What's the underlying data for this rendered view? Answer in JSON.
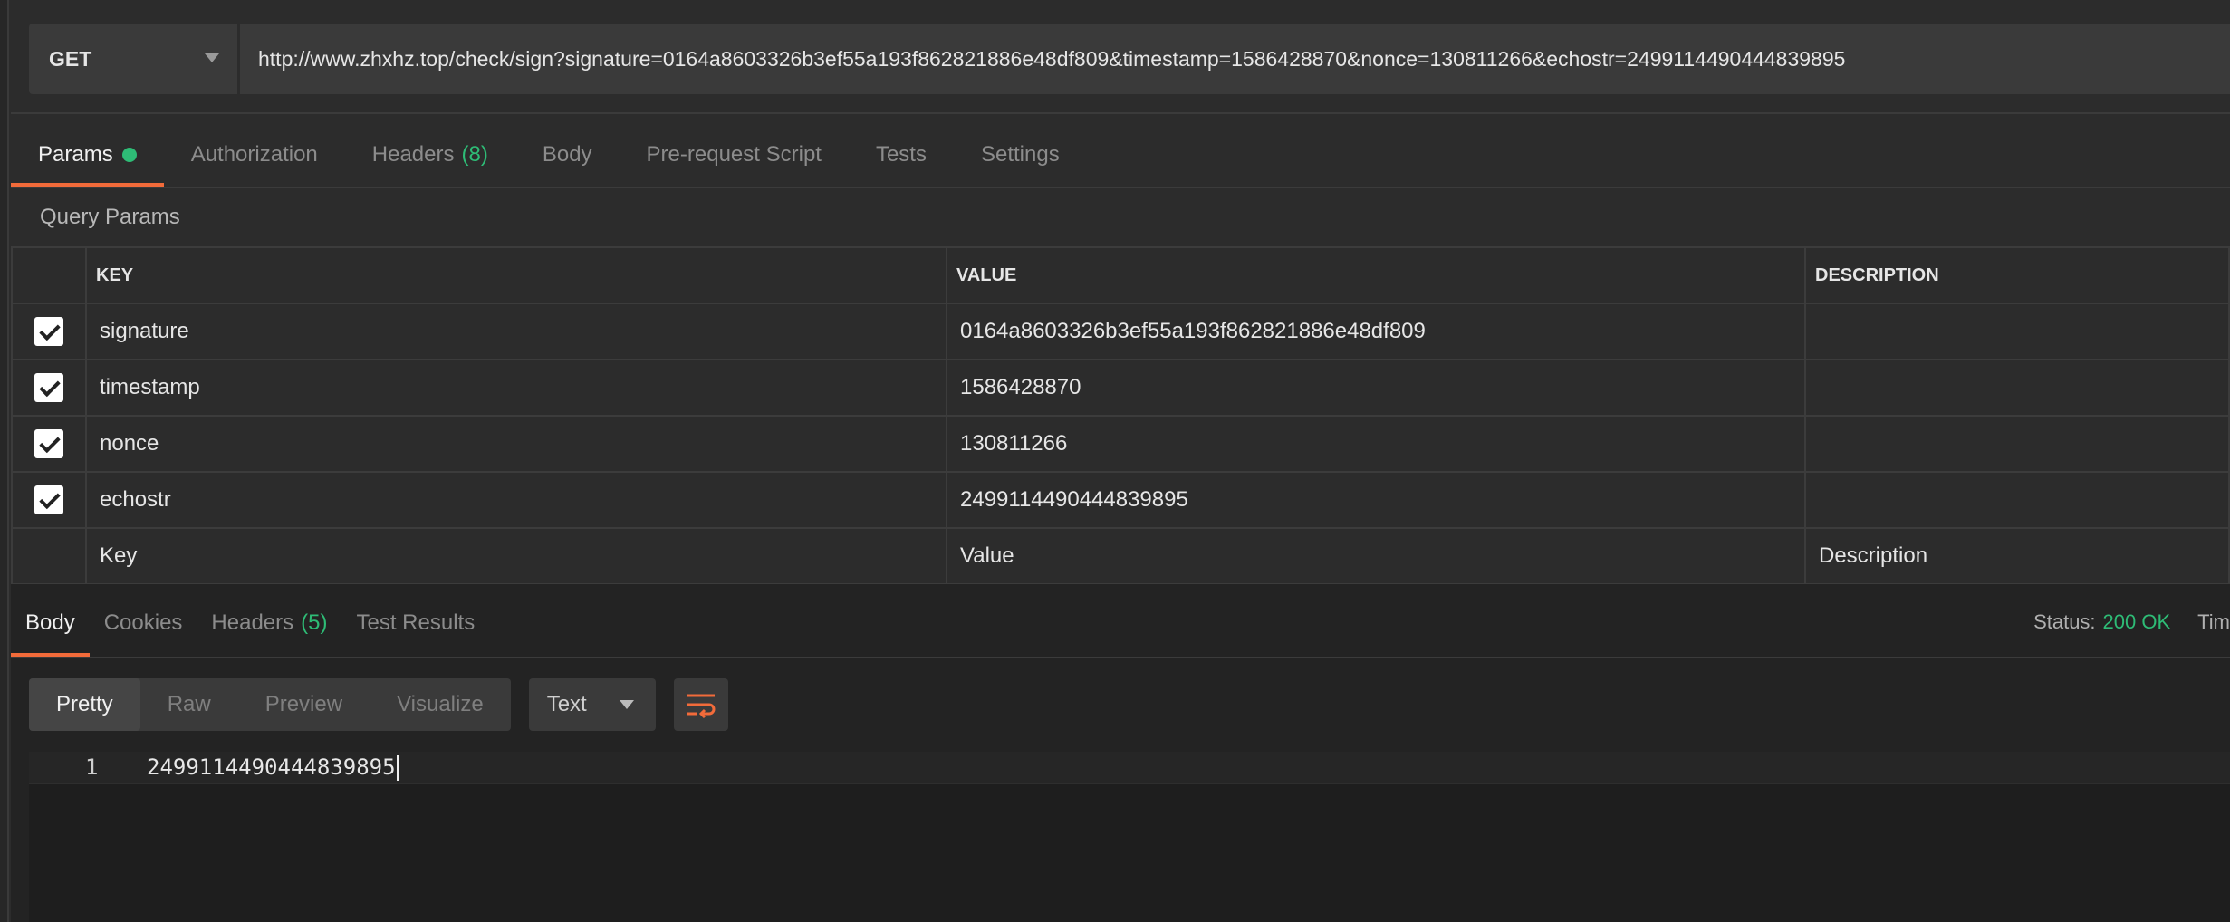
{
  "request": {
    "method": "GET",
    "url": "http://www.zhxhz.top/check/sign?signature=0164a8603326b3ef55a193f862821886e48df809&timestamp=1586428870&nonce=130811266&echostr=2499114490444839895"
  },
  "tabs": [
    {
      "label": "Params"
    },
    {
      "label": "Authorization"
    },
    {
      "label": "Headers",
      "count": "(8)"
    },
    {
      "label": "Body"
    },
    {
      "label": "Pre-request Script"
    },
    {
      "label": "Tests"
    },
    {
      "label": "Settings"
    }
  ],
  "query_params": {
    "title": "Query Params",
    "headers": {
      "key": "KEY",
      "value": "VALUE",
      "description": "DESCRIPTION"
    },
    "rows": [
      {
        "key": "signature",
        "value": "0164a8603326b3ef55a193f862821886e48df809",
        "description": "",
        "checked": true
      },
      {
        "key": "timestamp",
        "value": "1586428870",
        "description": "",
        "checked": true
      },
      {
        "key": "nonce",
        "value": "130811266",
        "description": "",
        "checked": true
      },
      {
        "key": "echostr",
        "value": "2499114490444839895",
        "description": "",
        "checked": true
      }
    ],
    "placeholders": {
      "key": "Key",
      "value": "Value",
      "description": "Description"
    }
  },
  "response": {
    "tabs": [
      {
        "label": "Body"
      },
      {
        "label": "Cookies"
      },
      {
        "label": "Headers",
        "count": "(5)"
      },
      {
        "label": "Test Results"
      }
    ],
    "status_label": "Status:",
    "status_value": "200 OK",
    "time_label": "Tim",
    "view_modes": [
      "Pretty",
      "Raw",
      "Preview",
      "Visualize"
    ],
    "format": "Text",
    "lines": [
      {
        "num": "1",
        "text": "2499114490444839895"
      }
    ]
  },
  "colors": {
    "accent": "#f26b3a",
    "success": "#2ebc76",
    "background": "#2c2c2c"
  }
}
